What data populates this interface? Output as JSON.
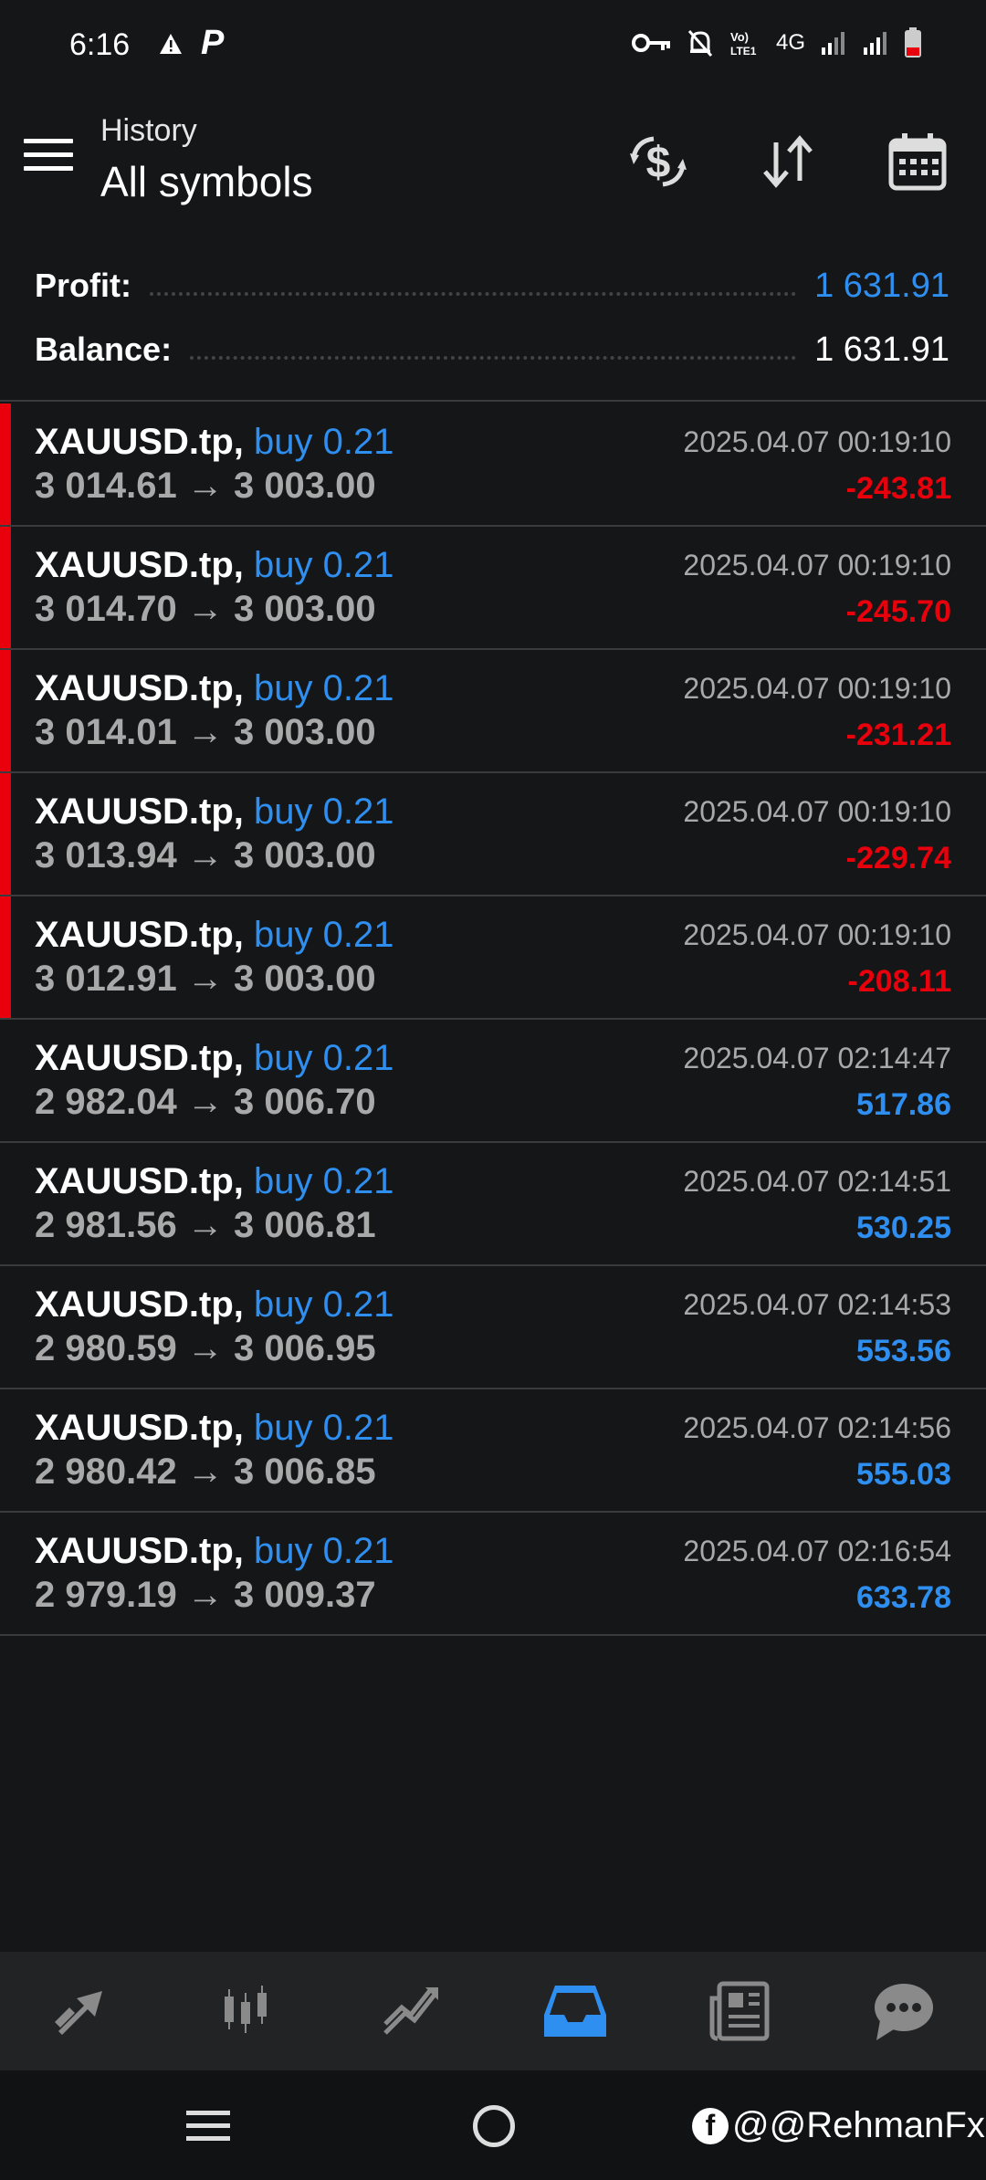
{
  "status_bar": {
    "time": "6:16",
    "network": "4G",
    "p_glyph": "P"
  },
  "app_bar": {
    "subtitle": "History",
    "title": "All symbols",
    "icons": [
      "menu-icon",
      "dollar-exchange-icon",
      "sort-icon",
      "calendar-icon"
    ]
  },
  "summary": {
    "profit_label": "Profit:",
    "profit_value": "1 631.91",
    "balance_label": "Balance:",
    "balance_value": "1 631.91"
  },
  "deals": [
    {
      "symbol": "XAUUSD.tp,",
      "side": "buy 0.21",
      "open": "3 014.61",
      "arrow": "→",
      "close": "3 003.00",
      "time": "2025.04.07 00:19:10",
      "profit": "-243.81",
      "loss": true
    },
    {
      "symbol": "XAUUSD.tp,",
      "side": "buy 0.21",
      "open": "3 014.70",
      "arrow": "→",
      "close": "3 003.00",
      "time": "2025.04.07 00:19:10",
      "profit": "-245.70",
      "loss": true
    },
    {
      "symbol": "XAUUSD.tp,",
      "side": "buy 0.21",
      "open": "3 014.01",
      "arrow": "→",
      "close": "3 003.00",
      "time": "2025.04.07 00:19:10",
      "profit": "-231.21",
      "loss": true
    },
    {
      "symbol": "XAUUSD.tp,",
      "side": "buy 0.21",
      "open": "3 013.94",
      "arrow": "→",
      "close": "3 003.00",
      "time": "2025.04.07 00:19:10",
      "profit": "-229.74",
      "loss": true
    },
    {
      "symbol": "XAUUSD.tp,",
      "side": "buy 0.21",
      "open": "3 012.91",
      "arrow": "→",
      "close": "3 003.00",
      "time": "2025.04.07 00:19:10",
      "profit": "-208.11",
      "loss": true
    },
    {
      "symbol": "XAUUSD.tp,",
      "side": "buy 0.21",
      "open": "2 982.04",
      "arrow": "→",
      "close": "3 006.70",
      "time": "2025.04.07 02:14:47",
      "profit": "517.86",
      "loss": false
    },
    {
      "symbol": "XAUUSD.tp,",
      "side": "buy 0.21",
      "open": "2 981.56",
      "arrow": "→",
      "close": "3 006.81",
      "time": "2025.04.07 02:14:51",
      "profit": "530.25",
      "loss": false
    },
    {
      "symbol": "XAUUSD.tp,",
      "side": "buy 0.21",
      "open": "2 980.59",
      "arrow": "→",
      "close": "3 006.95",
      "time": "2025.04.07 02:14:53",
      "profit": "553.56",
      "loss": false
    },
    {
      "symbol": "XAUUSD.tp,",
      "side": "buy 0.21",
      "open": "2 980.42",
      "arrow": "→",
      "close": "3 006.85",
      "time": "2025.04.07 02:14:56",
      "profit": "555.03",
      "loss": false
    },
    {
      "symbol": "XAUUSD.tp,",
      "side": "buy 0.21",
      "open": "2 979.19",
      "arrow": "→",
      "close": "3 009.37",
      "time": "2025.04.07 02:16:54",
      "profit": "633.78",
      "loss": false
    }
  ],
  "bottom_nav": {
    "items": [
      "quotes-icon",
      "chart-candles-icon",
      "trade-icon",
      "history-icon",
      "news-icon",
      "messages-icon"
    ],
    "active": "history-icon"
  },
  "colors": {
    "background": "#151617",
    "accent_blue": "#2f8ff0",
    "loss_red": "#e8000c",
    "muted_text": "#a9a9a9"
  },
  "watermark": {
    "text": "@@RehmanFx",
    "logo": "f"
  }
}
